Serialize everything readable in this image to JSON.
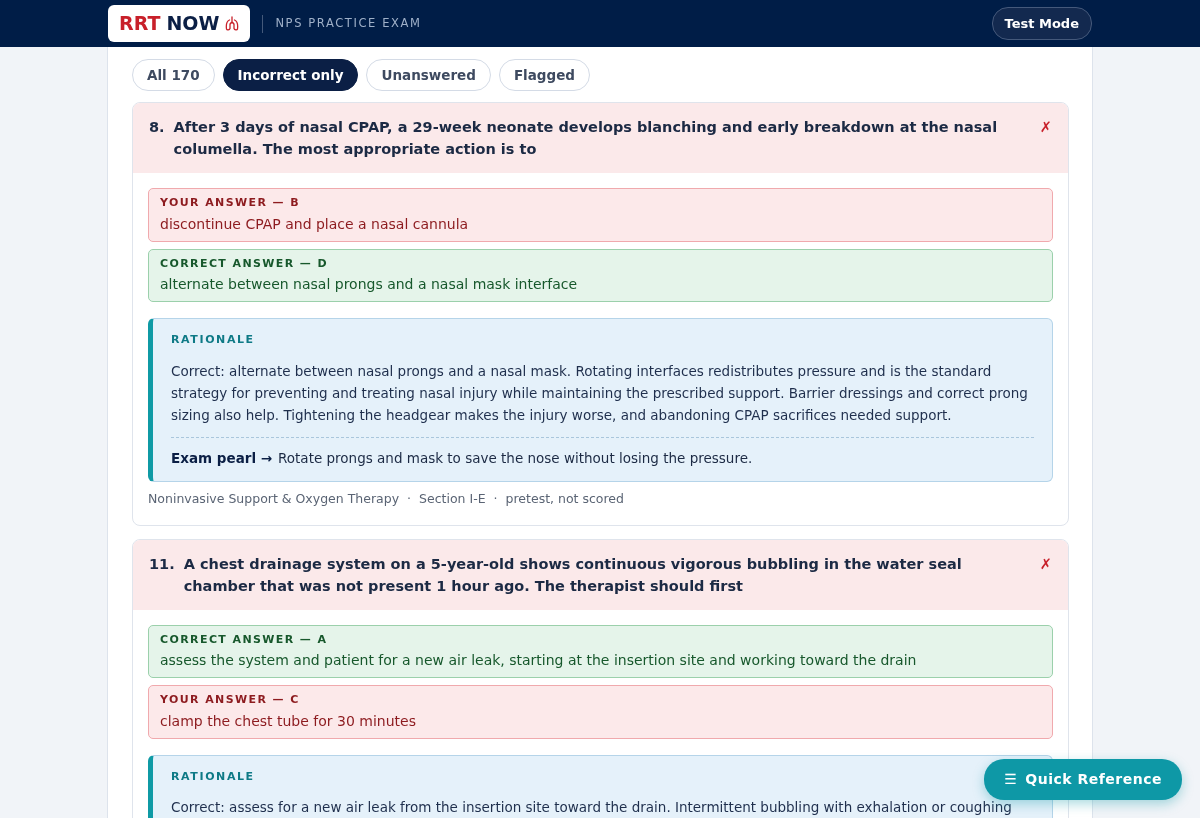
{
  "brand": {
    "part_1": "RRT",
    "part_2": "NOW"
  },
  "exam_title": "NPS PRACTICE EXAM",
  "mode_button": "Test Mode",
  "filters": [
    {
      "label": "All 170",
      "selected": false
    },
    {
      "label": "Incorrect only",
      "selected": true
    },
    {
      "label": "Unanswered",
      "selected": false
    },
    {
      "label": "Flagged",
      "selected": false
    }
  ],
  "questions": [
    {
      "number": "8.",
      "text": "After 3 days of nasal CPAP, a 29-week neonate develops blanching and early breakdown at the nasal columella. The most appropriate action is to",
      "mark": "✗",
      "answers": [
        {
          "kind": "yours",
          "label": "YOUR ANSWER — B",
          "text": "discontinue CPAP and place a nasal cannula"
        },
        {
          "kind": "correct",
          "label": "CORRECT ANSWER — D",
          "text": "alternate between nasal prongs and a nasal mask interface"
        }
      ],
      "rationale": {
        "label": "RATIONALE",
        "text": "Correct: alternate between nasal prongs and a nasal mask. Rotating interfaces redistributes pressure and is the standard strategy for preventing and treating nasal injury while maintaining the prescribed support. Barrier dressings and correct prong sizing also help. Tightening the headgear makes the injury worse, and abandoning CPAP sacrifices needed support.",
        "pearl_label": "Exam pearl →",
        "pearl": "Rotate prongs and mask to save the nose without losing the pressure."
      },
      "meta": [
        "Noninvasive Support & Oxygen Therapy",
        "·",
        "Section I-E",
        "·",
        "pretest, not scored"
      ]
    },
    {
      "number": "11.",
      "text": "A chest drainage system on a 5-year-old shows continuous vigorous bubbling in the water seal chamber that was not present 1 hour ago. The therapist should first",
      "mark": "✗",
      "answers": [
        {
          "kind": "correct",
          "label": "CORRECT ANSWER — A",
          "text": "assess the system and patient for a new air leak, starting at the insertion site and working toward the drain"
        },
        {
          "kind": "yours",
          "label": "YOUR ANSWER — C",
          "text": "clamp the chest tube for 30 minutes"
        }
      ],
      "rationale": {
        "label": "RATIONALE",
        "text": "Correct: assess for a new air leak from the insertion site toward the drain. Intermittent bubbling with exhalation or coughing"
      }
    }
  ],
  "quick_reference": {
    "icon": "☰",
    "label": "Quick Reference"
  }
}
